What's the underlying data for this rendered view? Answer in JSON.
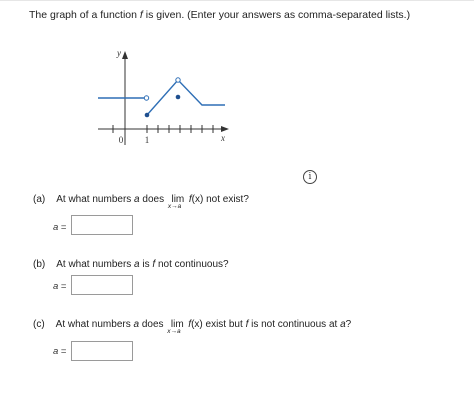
{
  "prompt": {
    "before_f": "The graph of a function ",
    "f": "f",
    "after_f": " is given. (Enter your answers as comma-separated lists.)"
  },
  "graph": {
    "y_axis_label": "y",
    "x_axis_label": "x",
    "origin_label": "0",
    "tick_label_1": "1"
  },
  "info_icon": "i",
  "questions": {
    "a": {
      "part": "(a)",
      "text1": "At what numbers ",
      "var_a": "a",
      "text2": " does ",
      "lim": "lim",
      "lim_sub": "x→a",
      "fx": "f",
      "x_paren": "(x)",
      "text3": " not exist?",
      "answer_label": "a",
      "answer_eq": " =",
      "answer_value": ""
    },
    "b": {
      "part": "(b)",
      "text1": "At what numbers ",
      "var_a": "a",
      "text2": " is ",
      "f": "f",
      "text3": " not continuous?",
      "answer_label": "a",
      "answer_eq": " =",
      "answer_value": ""
    },
    "c": {
      "part": "(c)",
      "text1": "At what numbers ",
      "var_a": "a",
      "text2": " does ",
      "lim": "lim",
      "lim_sub": "x→a",
      "fx": "f",
      "x_paren": "(x)",
      "text3": " exist but ",
      "f": "f",
      "text4": " is not continuous at ",
      "var_a2": "a",
      "text5": "?",
      "answer_label": "a",
      "answer_eq": " =",
      "answer_value": ""
    }
  }
}
